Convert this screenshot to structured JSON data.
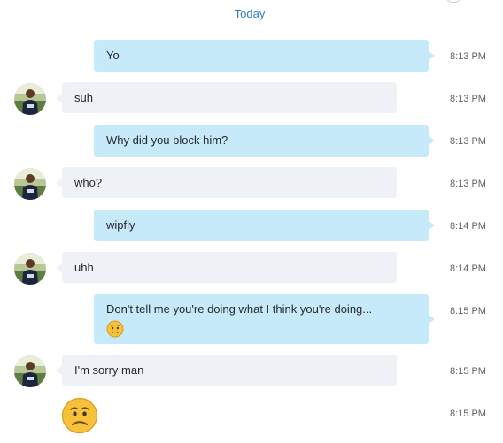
{
  "conversation": {
    "date_separator": "Today",
    "messages": [
      {
        "id": "m1",
        "direction": "outgoing",
        "text": "Yo",
        "time": "8:13 PM"
      },
      {
        "id": "m2",
        "direction": "incoming",
        "text": "suh",
        "time": "8:13 PM"
      },
      {
        "id": "m3",
        "direction": "outgoing",
        "text": "Why did you block him?",
        "time": "8:13 PM"
      },
      {
        "id": "m4",
        "direction": "incoming",
        "text": "who?",
        "time": "8:13 PM"
      },
      {
        "id": "m5",
        "direction": "outgoing",
        "text": "wipfly",
        "time": "8:14 PM"
      },
      {
        "id": "m6",
        "direction": "incoming",
        "text": "uhh",
        "time": "8:14 PM"
      },
      {
        "id": "m7",
        "direction": "outgoing",
        "text": "Don't tell me you're doing what I think you're doing...",
        "emoji": "worried-face",
        "time": "8:15 PM"
      },
      {
        "id": "m8",
        "direction": "incoming",
        "text": "I'm sorry man",
        "time": "8:15 PM"
      },
      {
        "id": "m9",
        "direction": "incoming",
        "emoji": "worried-face",
        "time": "8:15 PM"
      }
    ]
  },
  "colors": {
    "outgoing_bubble": "#c6eafa",
    "incoming_bubble": "#eef1f5",
    "date_label": "#2e7fc0",
    "timestamp": "#5e6266",
    "emoji_face": "#f7c23a"
  }
}
